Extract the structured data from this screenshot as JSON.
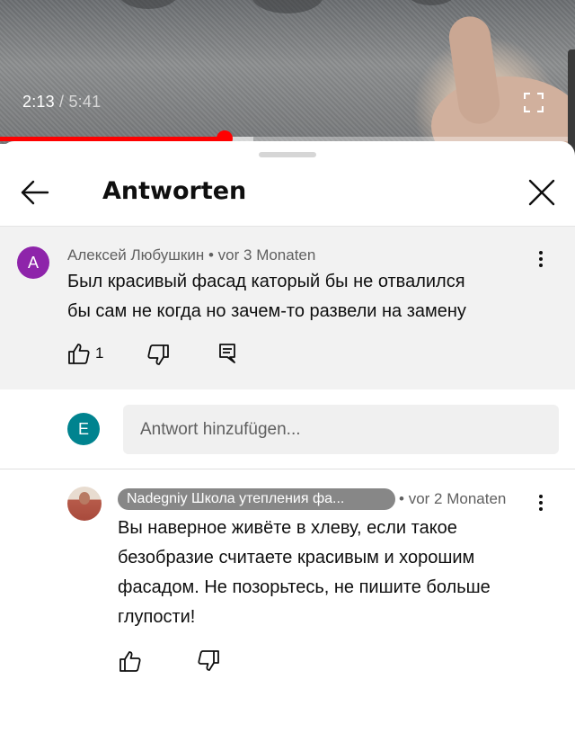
{
  "video": {
    "current_time": "2:13",
    "separator": "/",
    "duration": "5:41",
    "progress_fraction": 0.39,
    "buffered_fraction": 0.44,
    "accent_color": "#ff0000"
  },
  "sheet": {
    "title": "Antworten"
  },
  "parent_comment": {
    "avatar_letter": "A",
    "avatar_color": "#8e24aa",
    "author": "Алексей Любушкин",
    "dot": "•",
    "age": "vor 3 Monaten",
    "text_line1": "Был красивый фасад каторый бы не отвалился",
    "text_line2": "бы сам не когда но зачем-то развели на замену",
    "like_count": "1",
    "icons": [
      "thumb-up-icon",
      "thumb-down-icon",
      "reply-icon",
      "more-vert-icon"
    ]
  },
  "reply_input": {
    "avatar_letter": "E",
    "avatar_color": "#00838f",
    "placeholder": "Antwort hinzufügen..."
  },
  "reply": {
    "channel_name": "Nadegniy Школа утепления фа...",
    "dot": "•",
    "age": "vor 2 Monaten",
    "text_line1": "Вы наверное живёте в хлеву, если такое",
    "text_line2": "безобразие считаете красивым и хорошим",
    "text_line3": "фасадом. Не позорьтесь, не пишите больше",
    "text_line4": "глупости!",
    "icons": [
      "thumb-up-icon",
      "thumb-down-icon",
      "more-vert-icon"
    ]
  }
}
